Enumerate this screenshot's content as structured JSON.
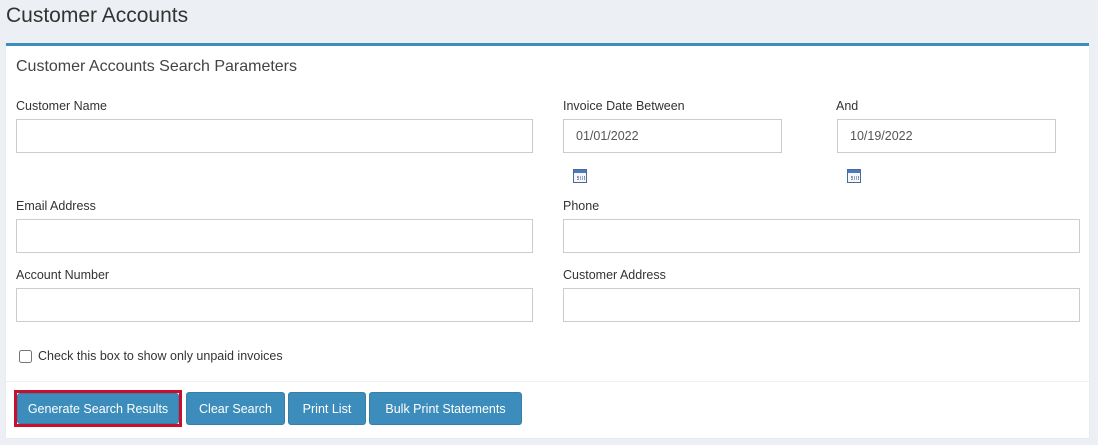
{
  "page": {
    "title": "Customer Accounts"
  },
  "panel": {
    "header": "Customer Accounts Search Parameters"
  },
  "fields": {
    "customer_name": {
      "label": "Customer Name",
      "value": ""
    },
    "invoice_date_start": {
      "label": "Invoice Date Between",
      "value": "01/01/2022"
    },
    "invoice_date_end": {
      "label": "And",
      "value": "10/19/2022"
    },
    "email": {
      "label": "Email Address",
      "value": ""
    },
    "phone": {
      "label": "Phone",
      "value": ""
    },
    "account_number": {
      "label": "Account Number",
      "value": ""
    },
    "customer_address": {
      "label": "Customer Address",
      "value": ""
    }
  },
  "checkbox": {
    "label": "Check this box to show only unpaid invoices",
    "checked": false
  },
  "buttons": {
    "generate": "Generate Search Results",
    "clear": "Clear Search",
    "print": "Print List",
    "bulk_print": "Bulk Print Statements"
  },
  "colors": {
    "accent": "#3c8dbc",
    "highlight": "#c8102e",
    "background": "#ecf0f5"
  },
  "icons": {
    "date_picker": "calendar-icon"
  }
}
